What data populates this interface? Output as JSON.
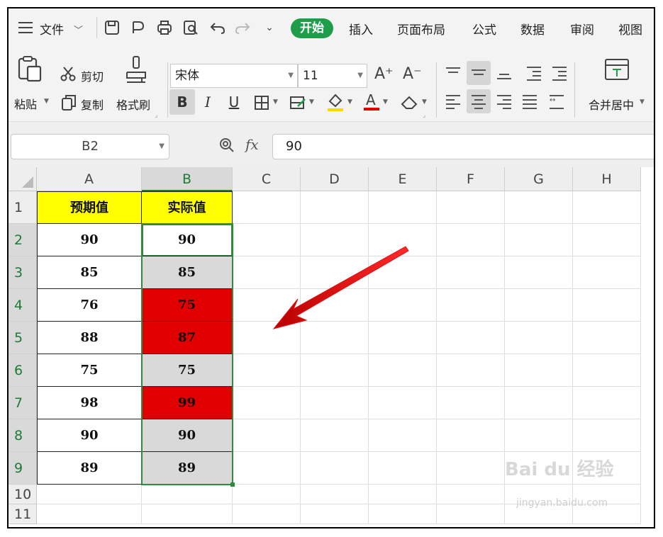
{
  "menubar": {
    "file_label": "文件",
    "start_label": "开始",
    "tabs": [
      "插入",
      "页面布局",
      "公式",
      "数据",
      "审阅",
      "视图"
    ]
  },
  "ribbon": {
    "paste_label": "粘贴",
    "cut_label": "剪切",
    "copy_label": "复制",
    "format_painter_label": "格式刷",
    "font_name": "宋体",
    "font_size": "11",
    "bold_label": "B",
    "italic_label": "I",
    "underline_label": "U",
    "merge_center_label": "合并居中",
    "font_color": "#e00000",
    "fill_color": "#ffd700"
  },
  "formula_bar": {
    "name_box": "B2",
    "fx_label": "fx",
    "formula_value": "90"
  },
  "sheet": {
    "columns": [
      "A",
      "B",
      "C",
      "D",
      "E",
      "F",
      "G",
      "H"
    ],
    "rows": [
      "1",
      "2",
      "3",
      "4",
      "5",
      "6",
      "7",
      "8",
      "9",
      "10",
      "11"
    ],
    "header_row": [
      "预期值",
      "实际值"
    ],
    "data": [
      {
        "expected": "90",
        "actual": "90",
        "actual_fill": "white"
      },
      {
        "expected": "85",
        "actual": "85",
        "actual_fill": "gray"
      },
      {
        "expected": "76",
        "actual": "75",
        "actual_fill": "red"
      },
      {
        "expected": "88",
        "actual": "87",
        "actual_fill": "red"
      },
      {
        "expected": "75",
        "actual": "75",
        "actual_fill": "gray"
      },
      {
        "expected": "98",
        "actual": "99",
        "actual_fill": "red"
      },
      {
        "expected": "90",
        "actual": "90",
        "actual_fill": "gray"
      },
      {
        "expected": "89",
        "actual": "89",
        "actual_fill": "gray"
      }
    ],
    "colors": {
      "header_fill": "#ffff00",
      "mismatch_fill": "#e00000",
      "match_fill": "#d9d9d9",
      "selection": "#2e8b3e"
    }
  },
  "watermark": {
    "brand": "Bai du 经验",
    "url": "jingyan.baidu.com"
  }
}
